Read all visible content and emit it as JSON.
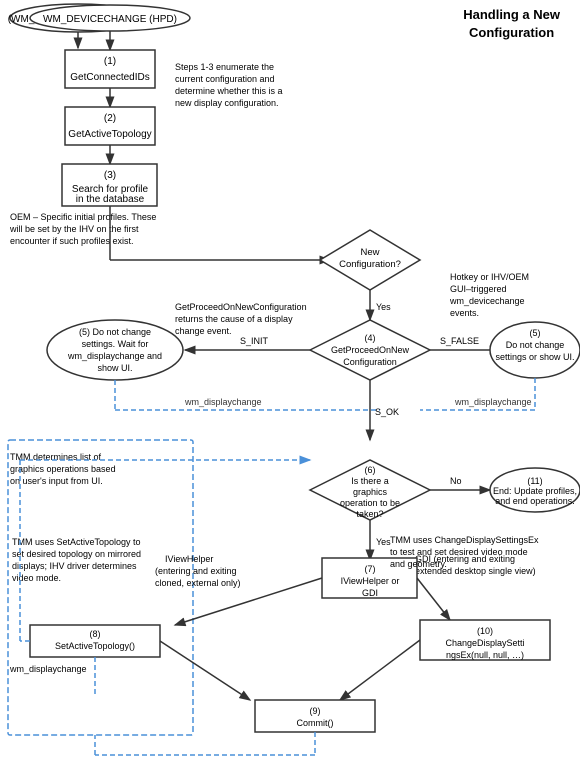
{
  "title": "Handling a New\nConfiguration",
  "nodes": {
    "wm_devicechange": "WM_DEVICECHANGE (HPD)",
    "node1": "(1)\nGetConnectedIDs",
    "node2": "(2)\nGetActiveTopology",
    "node3": "Search for profile\nin the database",
    "oem_note": "OEM – Specific initial profiles. These\nwill be set by the IHV on the first\nencounter if such profiles exist.",
    "new_config_diamond": "New\nConfiguration?",
    "steps_note": "Steps 1-3 enumerate the\ncurrent configuration and\ndetermine whether this is a\nnew display configuration.",
    "node4": "(4)\nGetProceedOnNew\nConfiguration",
    "get_proceed_note": "GetProceedOnNewConfiguration\nreturns the cause of a display\nchange event.",
    "node5_left": "(5) Do not change\nsettings. Wait for\nwm_displaychange and\nshow UI.",
    "node5_right": "(5)\nDo not change\nsettings or show UI.",
    "hotkey_note": "Hotkey or IHV/OEM\nGUI–triggered\nwm_devicechange\nevents.",
    "s_init": "S_INIT",
    "s_false": "S_FALSE",
    "s_ok": "S_OK",
    "wm_displaychange1": "wm_displaychange",
    "wm_displaychange2": "wm_displaychange",
    "node6": "(6)\nIs there a\ngraphics\noperation to be\ntaken?",
    "tmm_note1": "TMM determines list of\ngraphics operations based\non user's input from UI.",
    "node11": "(11)\nEnd: Update profiles,\nand end operations.",
    "no_label": "No",
    "yes_label": "Yes",
    "node7": "(7)\nIViewHelper or\nGDI",
    "iviewhelper_note": "IViewHelper\n(entering and exiting\ncloned, external only)",
    "gdi_note": "GDI (entering and exiting\nextended desktop single view)",
    "node8": "(8)\nSetActiveTopology()",
    "tmm_note2": "TMM uses SetActiveTopology to\nset desired topology on mirrored\ndisplays; IHV driver determines\nvideo mode.",
    "node10": "(10)\nChangeDisplaySetti\nngsEx(null, null, …)",
    "tmm_note3": "TMM uses ChangeDisplaySettingsEx\nto test and set desired video mode\nand geometry.",
    "node9": "(9)\nCommit()",
    "wm_displaychange3": "wm_displaychange"
  }
}
